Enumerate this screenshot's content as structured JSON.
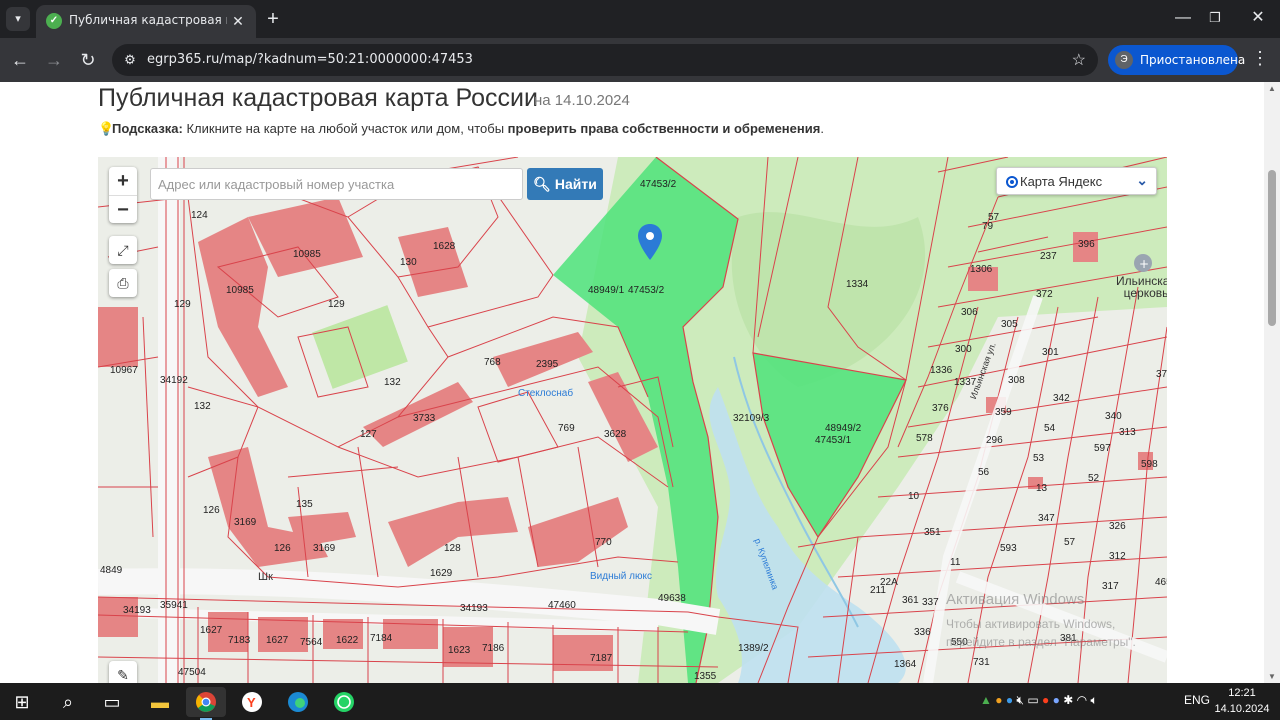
{
  "browser": {
    "tab_title": "Публичная кадастровая карт",
    "url": "egrp365.ru/map/?kadnum=50:21:0000000:47453",
    "profile_initial": "Э",
    "profile_status": "Приостановлена"
  },
  "page": {
    "title": "Публичная кадастровая карта России",
    "date": "на 14.10.2024",
    "hint_label": "Подсказка:",
    "hint_text": " Кликните на карте на любой участок или дом, чтобы ",
    "hint_bold": "проверить права собственности и обременения",
    "hint_end": "."
  },
  "map": {
    "search_placeholder": "Адрес или кадастровый номер участка",
    "search_button": "Найти",
    "zoom_in": "+",
    "zoom_out": "−",
    "layer": "Карта Яндекс",
    "parcel_labels": [
      "47453/2",
      "48949/1",
      "47453/2",
      "1334",
      "32109/3",
      "48949/2",
      "47453/1",
      "10985",
      "10985",
      "129",
      "129",
      "130",
      "1628",
      "124",
      "10967",
      "34192",
      "132",
      "132",
      "768",
      "2395",
      "769",
      "3733",
      "127",
      "3628",
      "126",
      "3169",
      "126",
      "3169",
      "135",
      "128",
      "1629",
      "770",
      "4849",
      "34193",
      "35941",
      "34193",
      "47460",
      "49638",
      "1627",
      "7183",
      "1627",
      "7564",
      "1622",
      "7184",
      "1623",
      "7186",
      "7187",
      "47504",
      "1389/2",
      "1355",
      "79",
      "57",
      "237",
      "396",
      "1306",
      "372",
      "306",
      "305",
      "300",
      "301",
      "1336",
      "1337",
      "308",
      "376",
      "359",
      "342",
      "340",
      "578",
      "296",
      "54",
      "597",
      "313",
      "56",
      "53",
      "52",
      "598",
      "13",
      "347",
      "351",
      "593",
      "57",
      "326",
      "312",
      "11",
      "317",
      "211",
      "361",
      "337",
      "336",
      "1364",
      "550",
      "731",
      "381",
      "4659",
      "371",
      "22А",
      "10"
    ],
    "place_labels": [
      "Ильинская церковь",
      "Стеклоснаб",
      "Шк",
      "Видный люкс",
      "р. Купелинка",
      "Ильинская ул."
    ],
    "watermark_title": "Активация Windows",
    "watermark_text": "Чтобы активировать Windows, перейдите в раздел \"Параметры\"."
  },
  "taskbar": {
    "lang": "ENG",
    "time": "12:21",
    "date": "14.10.2024",
    "apps": [
      "start-icon",
      "search-icon",
      "task-view-icon",
      "file-explorer-icon",
      "chrome-icon",
      "yandex-browser-icon",
      "edge-icon",
      "whatsapp-icon"
    ]
  },
  "colors": {
    "parcel_line": "#d9434b",
    "building": "#e58585",
    "selected_parcel": "#4de37a",
    "forest": "#c9ebb9",
    "button": "#337ab7"
  }
}
